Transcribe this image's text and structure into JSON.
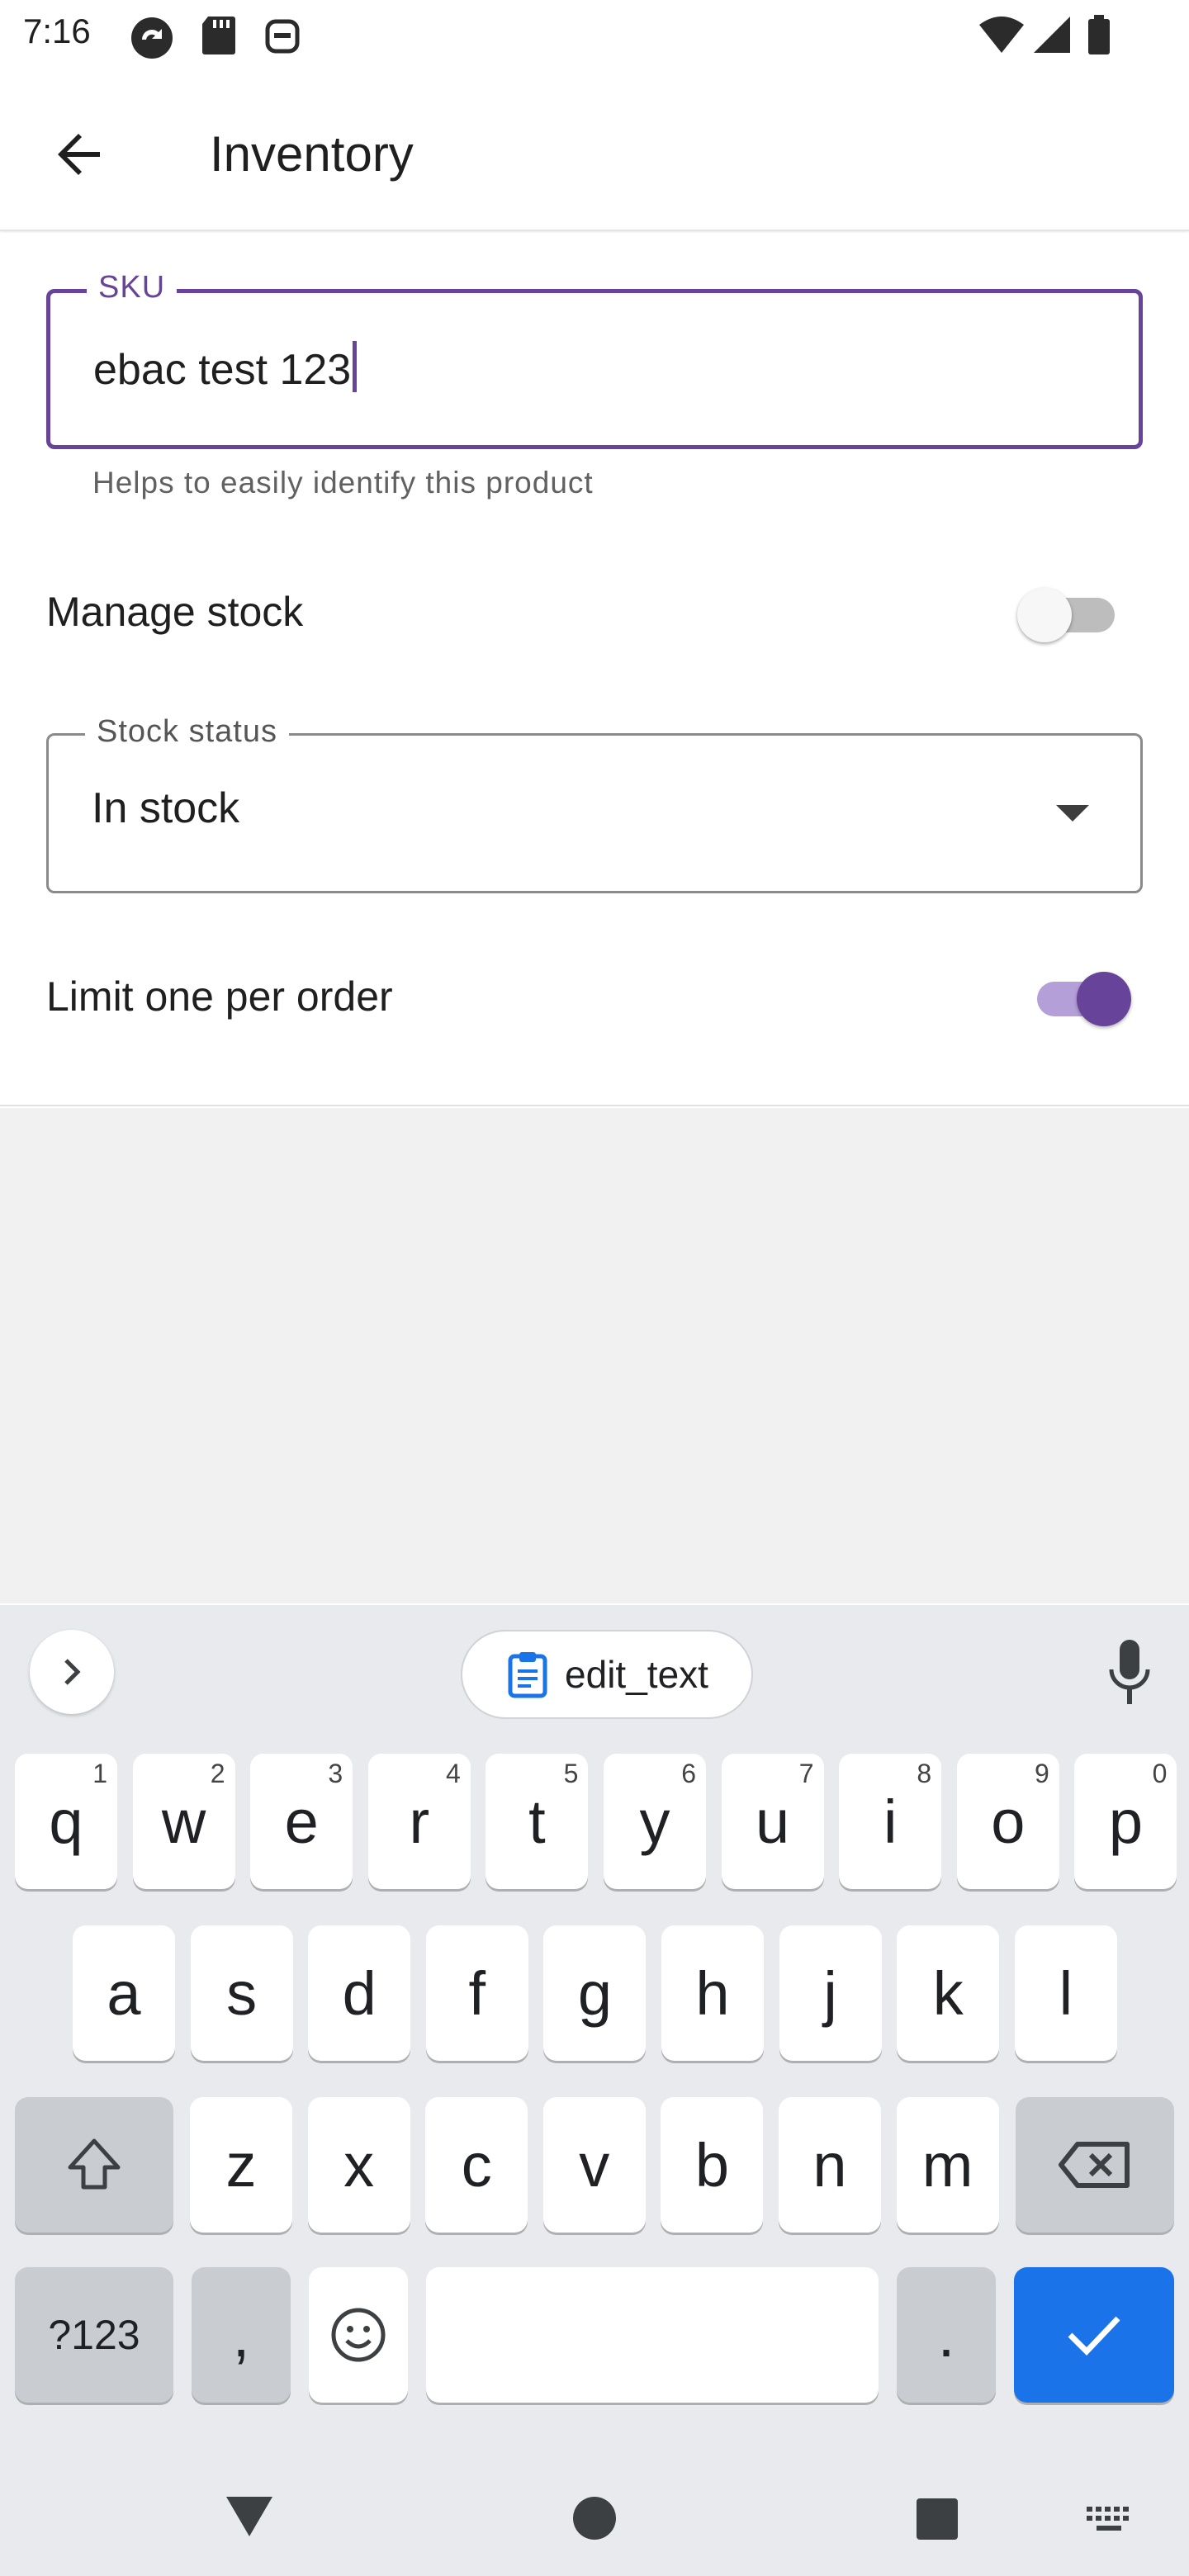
{
  "status_bar": {
    "time": "7:16"
  },
  "app_bar": {
    "title": "Inventory"
  },
  "sku_field": {
    "label": "SKU",
    "value": "ebac test 123",
    "helper": "Helps to easily identify this product"
  },
  "manage_stock": {
    "label": "Manage stock",
    "enabled": false
  },
  "stock_status": {
    "label": "Stock status",
    "value": "In stock"
  },
  "limit_one": {
    "label": "Limit one per order",
    "enabled": true
  },
  "keyboard": {
    "clipboard_chip": "edit_text",
    "row1": [
      "q",
      "w",
      "e",
      "r",
      "t",
      "y",
      "u",
      "i",
      "o",
      "p"
    ],
    "row1_hints": [
      "1",
      "2",
      "3",
      "4",
      "5",
      "6",
      "7",
      "8",
      "9",
      "0"
    ],
    "row2": [
      "a",
      "s",
      "d",
      "f",
      "g",
      "h",
      "j",
      "k",
      "l"
    ],
    "row3": [
      "z",
      "x",
      "c",
      "v",
      "b",
      "n",
      "m"
    ],
    "symbols_key": "?123",
    "comma_key": ",",
    "period_key": "."
  },
  "colors": {
    "accent": "#674399",
    "keyboard_bg": "#e8eaed",
    "enter_key": "#1a73e8"
  }
}
